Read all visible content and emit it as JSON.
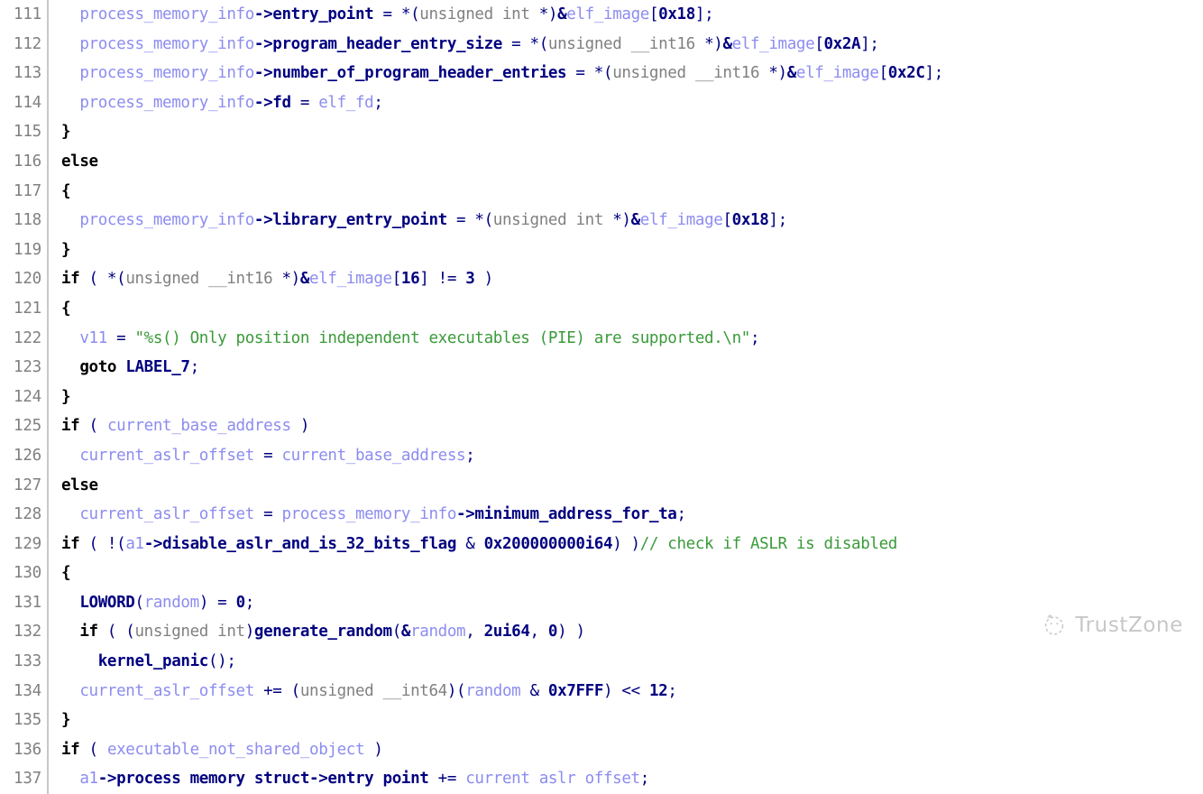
{
  "editor": {
    "kind": "decompiler-pseudocode",
    "first_line_number": 111,
    "last_line_number": 137,
    "background_color": "#ffffff",
    "gutter_color": "#808080",
    "colors": {
      "variable": "#8c8cf0",
      "member": "#000080",
      "type": "#808080",
      "keyword": "#000000",
      "string": "#3a9a3a",
      "comment": "#3a9a3a",
      "number": "#000080"
    }
  },
  "watermark": {
    "text": "TrustZone",
    "icon": "trustzone-logo-icon",
    "color": "#7b7b7b"
  },
  "lines": [
    {
      "number": "111",
      "text": "  process_memory_info->entry_point = *(unsigned int *)&elf_image[0x18];",
      "tokens": [
        {
          "t": "  ",
          "c": "t-plain"
        },
        {
          "t": "process_memory_info",
          "c": "t-var"
        },
        {
          "t": "->",
          "c": "t-member"
        },
        {
          "t": "entry_point",
          "c": "t-member"
        },
        {
          "t": " = *(",
          "c": "t-plain"
        },
        {
          "t": "unsigned int ",
          "c": "t-type"
        },
        {
          "t": "*)",
          "c": "t-plain"
        },
        {
          "t": "&",
          "c": "t-member"
        },
        {
          "t": "elf_image",
          "c": "t-var"
        },
        {
          "t": "[",
          "c": "t-plain"
        },
        {
          "t": "0x18",
          "c": "t-number"
        },
        {
          "t": "];",
          "c": "t-plain"
        }
      ]
    },
    {
      "number": "112",
      "text": "  process_memory_info->program_header_entry_size = *(unsigned __int16 *)&elf_image[0x2A];",
      "tokens": [
        {
          "t": "  ",
          "c": "t-plain"
        },
        {
          "t": "process_memory_info",
          "c": "t-var"
        },
        {
          "t": "->",
          "c": "t-member"
        },
        {
          "t": "program_header_entry_size",
          "c": "t-member"
        },
        {
          "t": " = *(",
          "c": "t-plain"
        },
        {
          "t": "unsigned __int16 ",
          "c": "t-type"
        },
        {
          "t": "*)",
          "c": "t-plain"
        },
        {
          "t": "&",
          "c": "t-member"
        },
        {
          "t": "elf_image",
          "c": "t-var"
        },
        {
          "t": "[",
          "c": "t-plain"
        },
        {
          "t": "0x2A",
          "c": "t-number"
        },
        {
          "t": "];",
          "c": "t-plain"
        }
      ]
    },
    {
      "number": "113",
      "text": "  process_memory_info->number_of_program_header_entries = *(unsigned __int16 *)&elf_image[0x2C];",
      "tokens": [
        {
          "t": "  ",
          "c": "t-plain"
        },
        {
          "t": "process_memory_info",
          "c": "t-var"
        },
        {
          "t": "->",
          "c": "t-member"
        },
        {
          "t": "number_of_program_header_entries",
          "c": "t-member"
        },
        {
          "t": " = *(",
          "c": "t-plain"
        },
        {
          "t": "unsigned __int16 ",
          "c": "t-type"
        },
        {
          "t": "*)",
          "c": "t-plain"
        },
        {
          "t": "&",
          "c": "t-member"
        },
        {
          "t": "elf_image",
          "c": "t-var"
        },
        {
          "t": "[",
          "c": "t-plain"
        },
        {
          "t": "0x2C",
          "c": "t-number"
        },
        {
          "t": "];",
          "c": "t-plain"
        }
      ]
    },
    {
      "number": "114",
      "text": "  process_memory_info->fd = elf_fd;",
      "tokens": [
        {
          "t": "  ",
          "c": "t-plain"
        },
        {
          "t": "process_memory_info",
          "c": "t-var"
        },
        {
          "t": "->",
          "c": "t-member"
        },
        {
          "t": "fd",
          "c": "t-member"
        },
        {
          "t": " = ",
          "c": "t-plain"
        },
        {
          "t": "elf_fd",
          "c": "t-var"
        },
        {
          "t": ";",
          "c": "t-plain"
        }
      ]
    },
    {
      "number": "115",
      "text": "}",
      "tokens": [
        {
          "t": "}",
          "c": "t-keyword"
        }
      ]
    },
    {
      "number": "116",
      "text": "else",
      "tokens": [
        {
          "t": "else",
          "c": "t-keyword"
        }
      ]
    },
    {
      "number": "117",
      "text": "{",
      "tokens": [
        {
          "t": "{",
          "c": "t-keyword"
        }
      ]
    },
    {
      "number": "118",
      "text": "  process_memory_info->library_entry_point = *(unsigned int *)&elf_image[0x18];",
      "tokens": [
        {
          "t": "  ",
          "c": "t-plain"
        },
        {
          "t": "process_memory_info",
          "c": "t-var"
        },
        {
          "t": "->",
          "c": "t-member"
        },
        {
          "t": "library_entry_point",
          "c": "t-member"
        },
        {
          "t": " = *(",
          "c": "t-plain"
        },
        {
          "t": "unsigned int ",
          "c": "t-type"
        },
        {
          "t": "*)",
          "c": "t-plain"
        },
        {
          "t": "&",
          "c": "t-member"
        },
        {
          "t": "elf_image",
          "c": "t-var"
        },
        {
          "t": "[",
          "c": "t-plain"
        },
        {
          "t": "0x18",
          "c": "t-number"
        },
        {
          "t": "];",
          "c": "t-plain"
        }
      ]
    },
    {
      "number": "119",
      "text": "}",
      "tokens": [
        {
          "t": "}",
          "c": "t-keyword"
        }
      ]
    },
    {
      "number": "120",
      "text": "if ( *(unsigned __int16 *)&elf_image[16] != 3 )",
      "tokens": [
        {
          "t": "if",
          "c": "t-keyword"
        },
        {
          "t": " ( *(",
          "c": "t-plain"
        },
        {
          "t": "unsigned __int16 ",
          "c": "t-type"
        },
        {
          "t": "*)",
          "c": "t-plain"
        },
        {
          "t": "&",
          "c": "t-member"
        },
        {
          "t": "elf_image",
          "c": "t-var"
        },
        {
          "t": "[",
          "c": "t-plain"
        },
        {
          "t": "16",
          "c": "t-number"
        },
        {
          "t": "] != ",
          "c": "t-plain"
        },
        {
          "t": "3",
          "c": "t-number"
        },
        {
          "t": " )",
          "c": "t-plain"
        }
      ]
    },
    {
      "number": "121",
      "text": "{",
      "tokens": [
        {
          "t": "{",
          "c": "t-keyword"
        }
      ]
    },
    {
      "number": "122",
      "text": "  v11 = \"%s() Only position independent executables (PIE) are supported.\\n\";",
      "tokens": [
        {
          "t": "  ",
          "c": "t-plain"
        },
        {
          "t": "v11",
          "c": "t-var"
        },
        {
          "t": " = ",
          "c": "t-plain"
        },
        {
          "t": "\"%s() Only position independent executables (PIE) are supported.\\n\"",
          "c": "t-string"
        },
        {
          "t": ";",
          "c": "t-plain"
        }
      ]
    },
    {
      "number": "123",
      "text": "  goto LABEL_7;",
      "tokens": [
        {
          "t": "  ",
          "c": "t-plain"
        },
        {
          "t": "goto",
          "c": "t-keyword"
        },
        {
          "t": " ",
          "c": "t-plain"
        },
        {
          "t": "LABEL_7",
          "c": "t-label"
        },
        {
          "t": ";",
          "c": "t-plain"
        }
      ]
    },
    {
      "number": "124",
      "text": "}",
      "tokens": [
        {
          "t": "}",
          "c": "t-keyword"
        }
      ]
    },
    {
      "number": "125",
      "text": "if ( current_base_address )",
      "tokens": [
        {
          "t": "if",
          "c": "t-keyword"
        },
        {
          "t": " ( ",
          "c": "t-plain"
        },
        {
          "t": "current_base_address",
          "c": "t-var"
        },
        {
          "t": " )",
          "c": "t-plain"
        }
      ]
    },
    {
      "number": "126",
      "text": "  current_aslr_offset = current_base_address;",
      "tokens": [
        {
          "t": "  ",
          "c": "t-plain"
        },
        {
          "t": "current_aslr_offset",
          "c": "t-var"
        },
        {
          "t": " = ",
          "c": "t-plain"
        },
        {
          "t": "current_base_address",
          "c": "t-var"
        },
        {
          "t": ";",
          "c": "t-plain"
        }
      ]
    },
    {
      "number": "127",
      "text": "else",
      "tokens": [
        {
          "t": "else",
          "c": "t-keyword"
        }
      ]
    },
    {
      "number": "128",
      "text": "  current_aslr_offset = process_memory_info->minimum_address_for_ta;",
      "tokens": [
        {
          "t": "  ",
          "c": "t-plain"
        },
        {
          "t": "current_aslr_offset",
          "c": "t-var"
        },
        {
          "t": " = ",
          "c": "t-plain"
        },
        {
          "t": "process_memory_info",
          "c": "t-var"
        },
        {
          "t": "->",
          "c": "t-member"
        },
        {
          "t": "minimum_address_for_ta",
          "c": "t-member"
        },
        {
          "t": ";",
          "c": "t-plain"
        }
      ]
    },
    {
      "number": "129",
      "text": "if ( !(a1->disable_aslr_and_is_32_bits_flag & 0x200000000i64) )// check if ASLR is disabled",
      "tokens": [
        {
          "t": "if",
          "c": "t-keyword"
        },
        {
          "t": " ( !(",
          "c": "t-plain"
        },
        {
          "t": "a1",
          "c": "t-var"
        },
        {
          "t": "->",
          "c": "t-member"
        },
        {
          "t": "disable_aslr_and_is_32_bits_flag",
          "c": "t-member"
        },
        {
          "t": " & ",
          "c": "t-plain"
        },
        {
          "t": "0x200000000i64",
          "c": "t-number"
        },
        {
          "t": ") )",
          "c": "t-plain"
        },
        {
          "t": "// check if ASLR is disabled",
          "c": "t-comment"
        }
      ]
    },
    {
      "number": "130",
      "text": "{",
      "tokens": [
        {
          "t": "{",
          "c": "t-keyword"
        }
      ]
    },
    {
      "number": "131",
      "text": "  LOWORD(random) = 0;",
      "tokens": [
        {
          "t": "  ",
          "c": "t-plain"
        },
        {
          "t": "LOWORD",
          "c": "t-func"
        },
        {
          "t": "(",
          "c": "t-plain"
        },
        {
          "t": "random",
          "c": "t-var"
        },
        {
          "t": ") = ",
          "c": "t-plain"
        },
        {
          "t": "0",
          "c": "t-number"
        },
        {
          "t": ";",
          "c": "t-plain"
        }
      ]
    },
    {
      "number": "132",
      "text": "  if ( (unsigned int)generate_random(&random, 2ui64, 0) )",
      "tokens": [
        {
          "t": "  ",
          "c": "t-plain"
        },
        {
          "t": "if",
          "c": "t-keyword"
        },
        {
          "t": " ( (",
          "c": "t-plain"
        },
        {
          "t": "unsigned int",
          "c": "t-type"
        },
        {
          "t": ")",
          "c": "t-plain"
        },
        {
          "t": "generate_random",
          "c": "t-func"
        },
        {
          "t": "(",
          "c": "t-plain"
        },
        {
          "t": "&",
          "c": "t-member"
        },
        {
          "t": "random",
          "c": "t-var"
        },
        {
          "t": ", ",
          "c": "t-plain"
        },
        {
          "t": "2ui64",
          "c": "t-number"
        },
        {
          "t": ", ",
          "c": "t-plain"
        },
        {
          "t": "0",
          "c": "t-number"
        },
        {
          "t": ") )",
          "c": "t-plain"
        }
      ]
    },
    {
      "number": "133",
      "text": "    kernel_panic();",
      "tokens": [
        {
          "t": "    ",
          "c": "t-plain"
        },
        {
          "t": "kernel_panic",
          "c": "t-func"
        },
        {
          "t": "();",
          "c": "t-plain"
        }
      ]
    },
    {
      "number": "134",
      "text": "  current_aslr_offset += (unsigned __int64)(random & 0x7FFF) << 12;",
      "tokens": [
        {
          "t": "  ",
          "c": "t-plain"
        },
        {
          "t": "current_aslr_offset",
          "c": "t-var"
        },
        {
          "t": " += (",
          "c": "t-plain"
        },
        {
          "t": "unsigned __int64",
          "c": "t-type"
        },
        {
          "t": ")(",
          "c": "t-plain"
        },
        {
          "t": "random",
          "c": "t-var"
        },
        {
          "t": " & ",
          "c": "t-plain"
        },
        {
          "t": "0x7FFF",
          "c": "t-number"
        },
        {
          "t": ") << ",
          "c": "t-plain"
        },
        {
          "t": "12",
          "c": "t-number"
        },
        {
          "t": ";",
          "c": "t-plain"
        }
      ]
    },
    {
      "number": "135",
      "text": "}",
      "tokens": [
        {
          "t": "}",
          "c": "t-keyword"
        }
      ]
    },
    {
      "number": "136",
      "text": "if ( executable_not_shared_object )",
      "tokens": [
        {
          "t": "if",
          "c": "t-keyword"
        },
        {
          "t": " ( ",
          "c": "t-plain"
        },
        {
          "t": "executable_not_shared_object",
          "c": "t-var"
        },
        {
          "t": " )",
          "c": "t-plain"
        }
      ]
    },
    {
      "number": "137",
      "text": "  a1->process memory struct->entry point += current aslr offset;",
      "tokens": [
        {
          "t": "  ",
          "c": "t-plain"
        },
        {
          "t": "a1",
          "c": "t-var"
        },
        {
          "t": "->",
          "c": "t-member"
        },
        {
          "t": "process memory struct",
          "c": "t-member"
        },
        {
          "t": "->",
          "c": "t-member"
        },
        {
          "t": "entry point",
          "c": "t-member"
        },
        {
          "t": " += ",
          "c": "t-plain"
        },
        {
          "t": "current aslr offset",
          "c": "t-var"
        },
        {
          "t": ";",
          "c": "t-plain"
        }
      ]
    }
  ]
}
